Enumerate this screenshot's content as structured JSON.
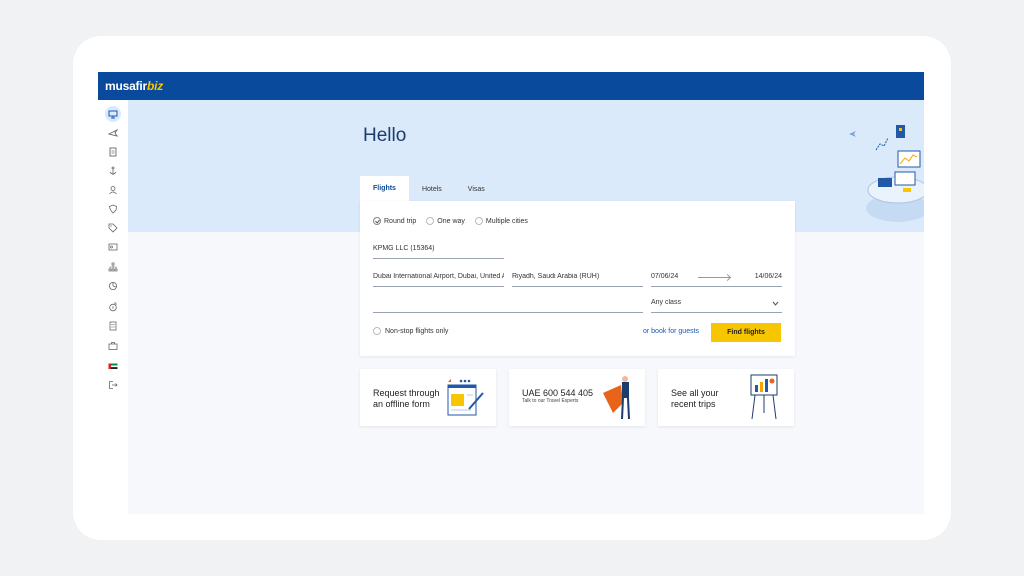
{
  "brand": {
    "name_main": "musafir",
    "name_accent": "biz"
  },
  "hero": {
    "greeting": "Hello"
  },
  "tabs": [
    {
      "label": "Flights",
      "active": true
    },
    {
      "label": "Hotels",
      "active": false
    },
    {
      "label": "Visas",
      "active": false
    }
  ],
  "trip_types": [
    {
      "label": "Round trip",
      "selected": true
    },
    {
      "label": "One way",
      "selected": false
    },
    {
      "label": "Multiple cities",
      "selected": false
    }
  ],
  "search": {
    "company": "KPMG LLC (15364)",
    "from": "Dubai International Airport, Dubai, United Arab Emirates (DXB)",
    "to": "Riyadh, Saudi Arabia (RUH)",
    "depart_date": "07/06/24",
    "return_date": "14/06/24",
    "travellers": "",
    "cabin_class": "Any class",
    "nonstop_label": "Non-stop flights only",
    "guests_link": "or book for guests",
    "find_button": "Find flights"
  },
  "tiles": {
    "offline": {
      "text": "Request through an offline form"
    },
    "phone": {
      "text": "UAE 600 544 405",
      "sub": "Talk to our Travel Experts"
    },
    "trips": {
      "text": "See all your recent trips"
    }
  },
  "colors": {
    "brand_blue": "#0a4a9c",
    "accent_yellow": "#f7c600",
    "hero_bg": "#dbeafb"
  },
  "sidebar_icons": [
    "dashboard-icon",
    "flight-icon",
    "document-icon",
    "anchor-icon",
    "user-badge-icon",
    "shield-icon",
    "tag-icon",
    "id-card-icon",
    "hierarchy-icon",
    "pie-chart-icon",
    "money-icon",
    "building-icon",
    "briefcase-icon",
    "uae-flag-icon",
    "logout-icon"
  ]
}
